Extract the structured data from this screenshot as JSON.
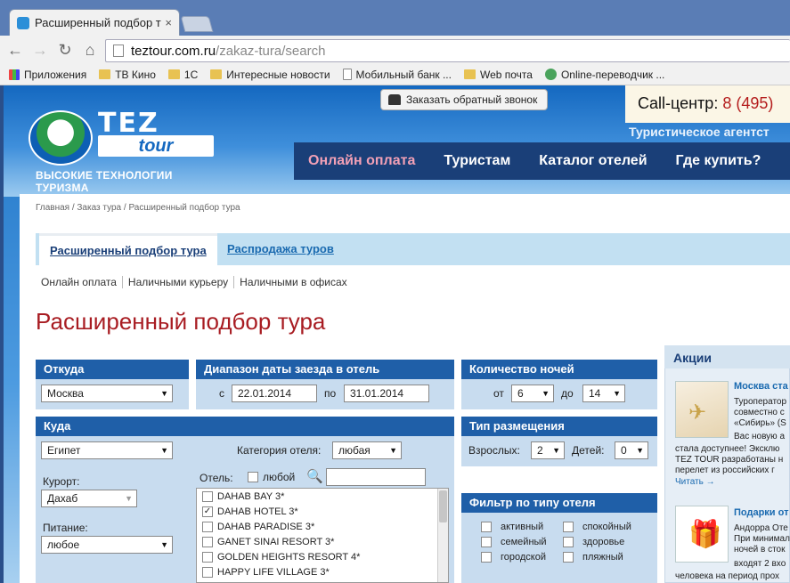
{
  "browser": {
    "tab_title": "Расширенный подбор т",
    "tab_close": "×",
    "url_domain": "teztour.com.ru",
    "url_path": "/zakaz-tura/search",
    "bookmarks": [
      {
        "label": "Приложения",
        "icon": "apps-icon"
      },
      {
        "label": "ТВ Кино",
        "icon": "folder-icon"
      },
      {
        "label": "1С",
        "icon": "folder-icon"
      },
      {
        "label": "Интересные новости",
        "icon": "folder-icon"
      },
      {
        "label": "Мобильный банк ...",
        "icon": "page-icon"
      },
      {
        "label": "Web почта",
        "icon": "folder-icon"
      },
      {
        "label": "Online-переводчик ...",
        "icon": "globe-icon"
      }
    ]
  },
  "header": {
    "logo_tez": "TEZ",
    "logo_tour": "tour",
    "slogan": "ВЫСОКИЕ ТЕХНОЛОГИИ ТУРИЗМА",
    "callback_label": "Заказать обратный звонок",
    "callcenter_label": "Call-центр:",
    "callcenter_number": "8 (495)",
    "agency": "Туристическое агентст",
    "nav": [
      "Онлайн оплата",
      "Туристам",
      "Каталог отелей",
      "Где купить?"
    ]
  },
  "breadcrumb": "Главная / Заказ тура / Расширенный подбор тура",
  "tabs": [
    "Расширенный подбор тура",
    "Распродажа туров"
  ],
  "pay_links": [
    "Онлайн оплата",
    "Наличными курьеру",
    "Наличными в офисах"
  ],
  "page_title": "Расширенный подбор тура",
  "form": {
    "from_header": "Откуда",
    "from_value": "Москва",
    "dates_header": "Диапазон даты заезда в отель",
    "date_from_label": "с",
    "date_from": "22.01.2014",
    "date_to_label": "по",
    "date_to": "31.01.2014",
    "nights_header": "Количество ночей",
    "nights_from_label": "от",
    "nights_from": "6",
    "nights_to_label": "до",
    "nights_to": "14",
    "to_header": "Куда",
    "to_value": "Египет",
    "hotel_category_label": "Категория отеля:",
    "hotel_category_value": "любая",
    "resort_label": "Курорт:",
    "resort_value": "Дахаб",
    "meal_label": "Питание:",
    "meal_value": "любое",
    "hotel_label": "Отель:",
    "hotel_any_label": "любой",
    "hotels": [
      {
        "name": "DAHAB BAY 3*",
        "checked": false
      },
      {
        "name": "DAHAB HOTEL 3*",
        "checked": true
      },
      {
        "name": "DAHAB PARADISE 3*",
        "checked": false
      },
      {
        "name": "GANET SINAI RESORT 3*",
        "checked": false
      },
      {
        "name": "GOLDEN HEIGHTS RESORT 4*",
        "checked": false
      },
      {
        "name": "HAPPY LIFE VILLAGE 3*",
        "checked": false
      }
    ],
    "accommodation_header": "Тип размещения",
    "adults_label": "Взрослых:",
    "adults_value": "2",
    "children_label": "Детей:",
    "children_value": "0",
    "hotel_type_header": "Фильтр по типу отеля",
    "hotel_types": [
      "активный",
      "спокойный",
      "семейный",
      "здоровье",
      "городской",
      "пляжный"
    ]
  },
  "promo": {
    "header": "Акции",
    "items": [
      {
        "title": "Москва ста",
        "lines": [
          "Туроператор",
          "совместно с",
          "«Сибирь» (S",
          "Вас новую а",
          "стала доступнее! Эксклю",
          "TEZ TOUR разработаны н",
          "перелет из российских г"
        ],
        "more": "Читать →"
      },
      {
        "title": "Подарки от",
        "lines": [
          "Андорра Оте",
          "При минимал",
          "ночей в сток",
          "входят 2 вхо",
          "человека на период прох"
        ]
      }
    ]
  },
  "colors": {
    "nav_bg": "#1a3f78",
    "panel_header": "#1f5fa8",
    "title_red": "#a81c22",
    "accent_pink": "#f2a0b6"
  }
}
